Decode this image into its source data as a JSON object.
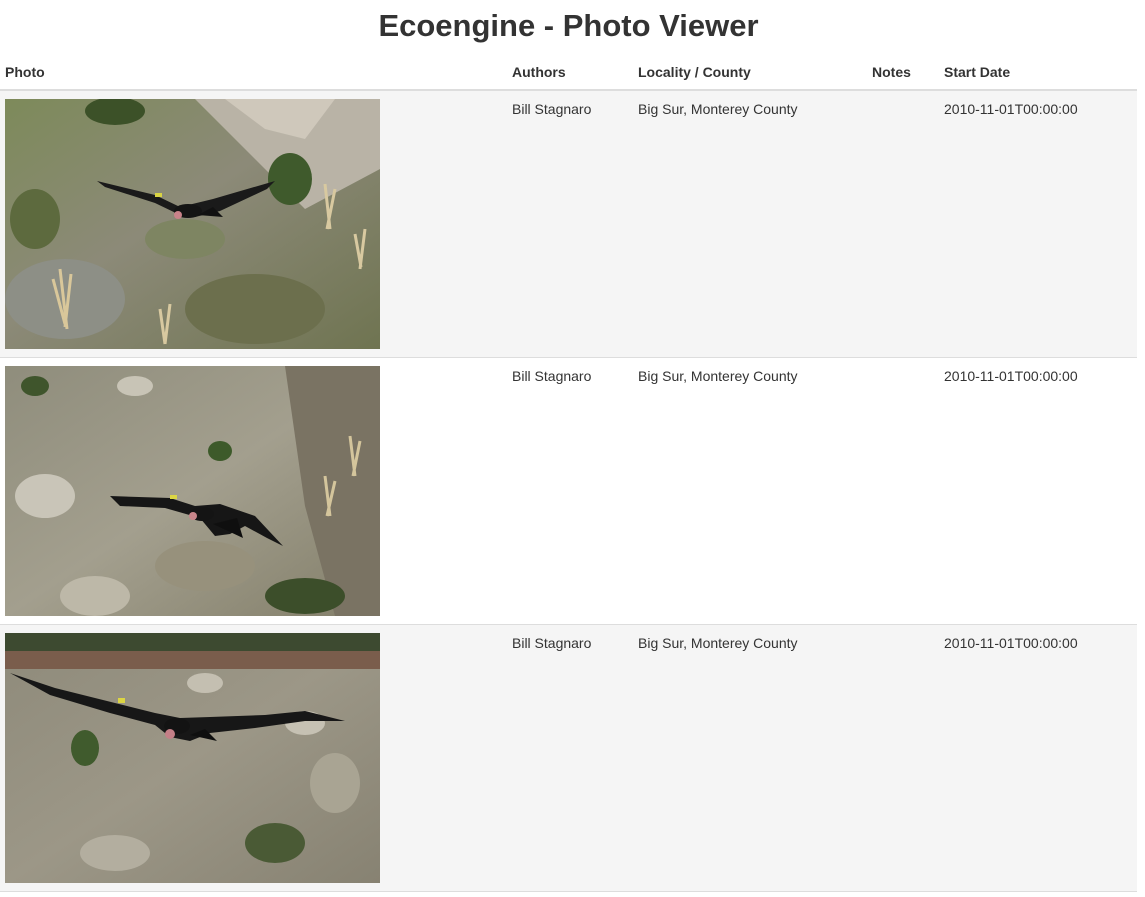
{
  "page": {
    "title": "Ecoengine - Photo Viewer"
  },
  "table": {
    "headers": {
      "photo": "Photo",
      "authors": "Authors",
      "locality": "Locality / County",
      "notes": "Notes",
      "start_date": "Start Date"
    },
    "rows": [
      {
        "authors": "Bill Stagnaro",
        "locality": "Big Sur, Monterey County",
        "notes": "",
        "start_date": "2010-11-01T00:00:00"
      },
      {
        "authors": "Bill Stagnaro",
        "locality": "Big Sur, Monterey County",
        "notes": "",
        "start_date": "2010-11-01T00:00:00"
      },
      {
        "authors": "Bill Stagnaro",
        "locality": "Big Sur, Monterey County",
        "notes": "",
        "start_date": "2010-11-01T00:00:00"
      }
    ]
  },
  "colors": {
    "text": "#333333",
    "row_stripe": "#f5f5f5",
    "border": "#dddddd"
  }
}
